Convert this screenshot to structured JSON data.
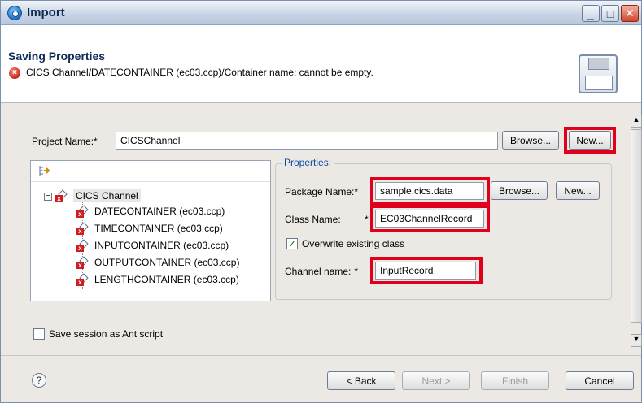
{
  "window": {
    "title": "Import"
  },
  "header": {
    "title": "Saving Properties",
    "error_message": "CICS Channel/DATECONTAINER (ec03.ccp)/Container name: cannot be empty."
  },
  "project": {
    "label": "Project Name:",
    "value": "CICSChannel",
    "browse_label": "Browse...",
    "new_label": "New..."
  },
  "tree": {
    "root_label": "CICS Channel",
    "items": [
      {
        "label": "DATECONTAINER (ec03.ccp)"
      },
      {
        "label": "TIMECONTAINER (ec03.ccp)"
      },
      {
        "label": "INPUTCONTAINER (ec03.ccp)"
      },
      {
        "label": "OUTPUTCONTAINER (ec03.ccp)"
      },
      {
        "label": "LENGTHCONTAINER (ec03.ccp)"
      }
    ]
  },
  "properties": {
    "group_label": "Properties:",
    "package_label": "Package Name:",
    "package_value": "sample.cics.data",
    "package_browse_label": "Browse...",
    "package_new_label": "New...",
    "class_label": "Class Name:",
    "class_value": "EC03ChannelRecord",
    "overwrite_label": "Overwrite existing class",
    "overwrite_checked": true,
    "channel_label": "Channel name:",
    "channel_value": "InputRecord",
    "required_marker": "*"
  },
  "save_session": {
    "label": "Save session as Ant script",
    "checked": false
  },
  "footer": {
    "back_label": "< Back",
    "next_label": "Next >",
    "finish_label": "Finish",
    "cancel_label": "Cancel"
  },
  "colors": {
    "highlight_red": "#e0001b",
    "group_label_blue": "#0b4ea2",
    "error_red": "#c5261a"
  }
}
